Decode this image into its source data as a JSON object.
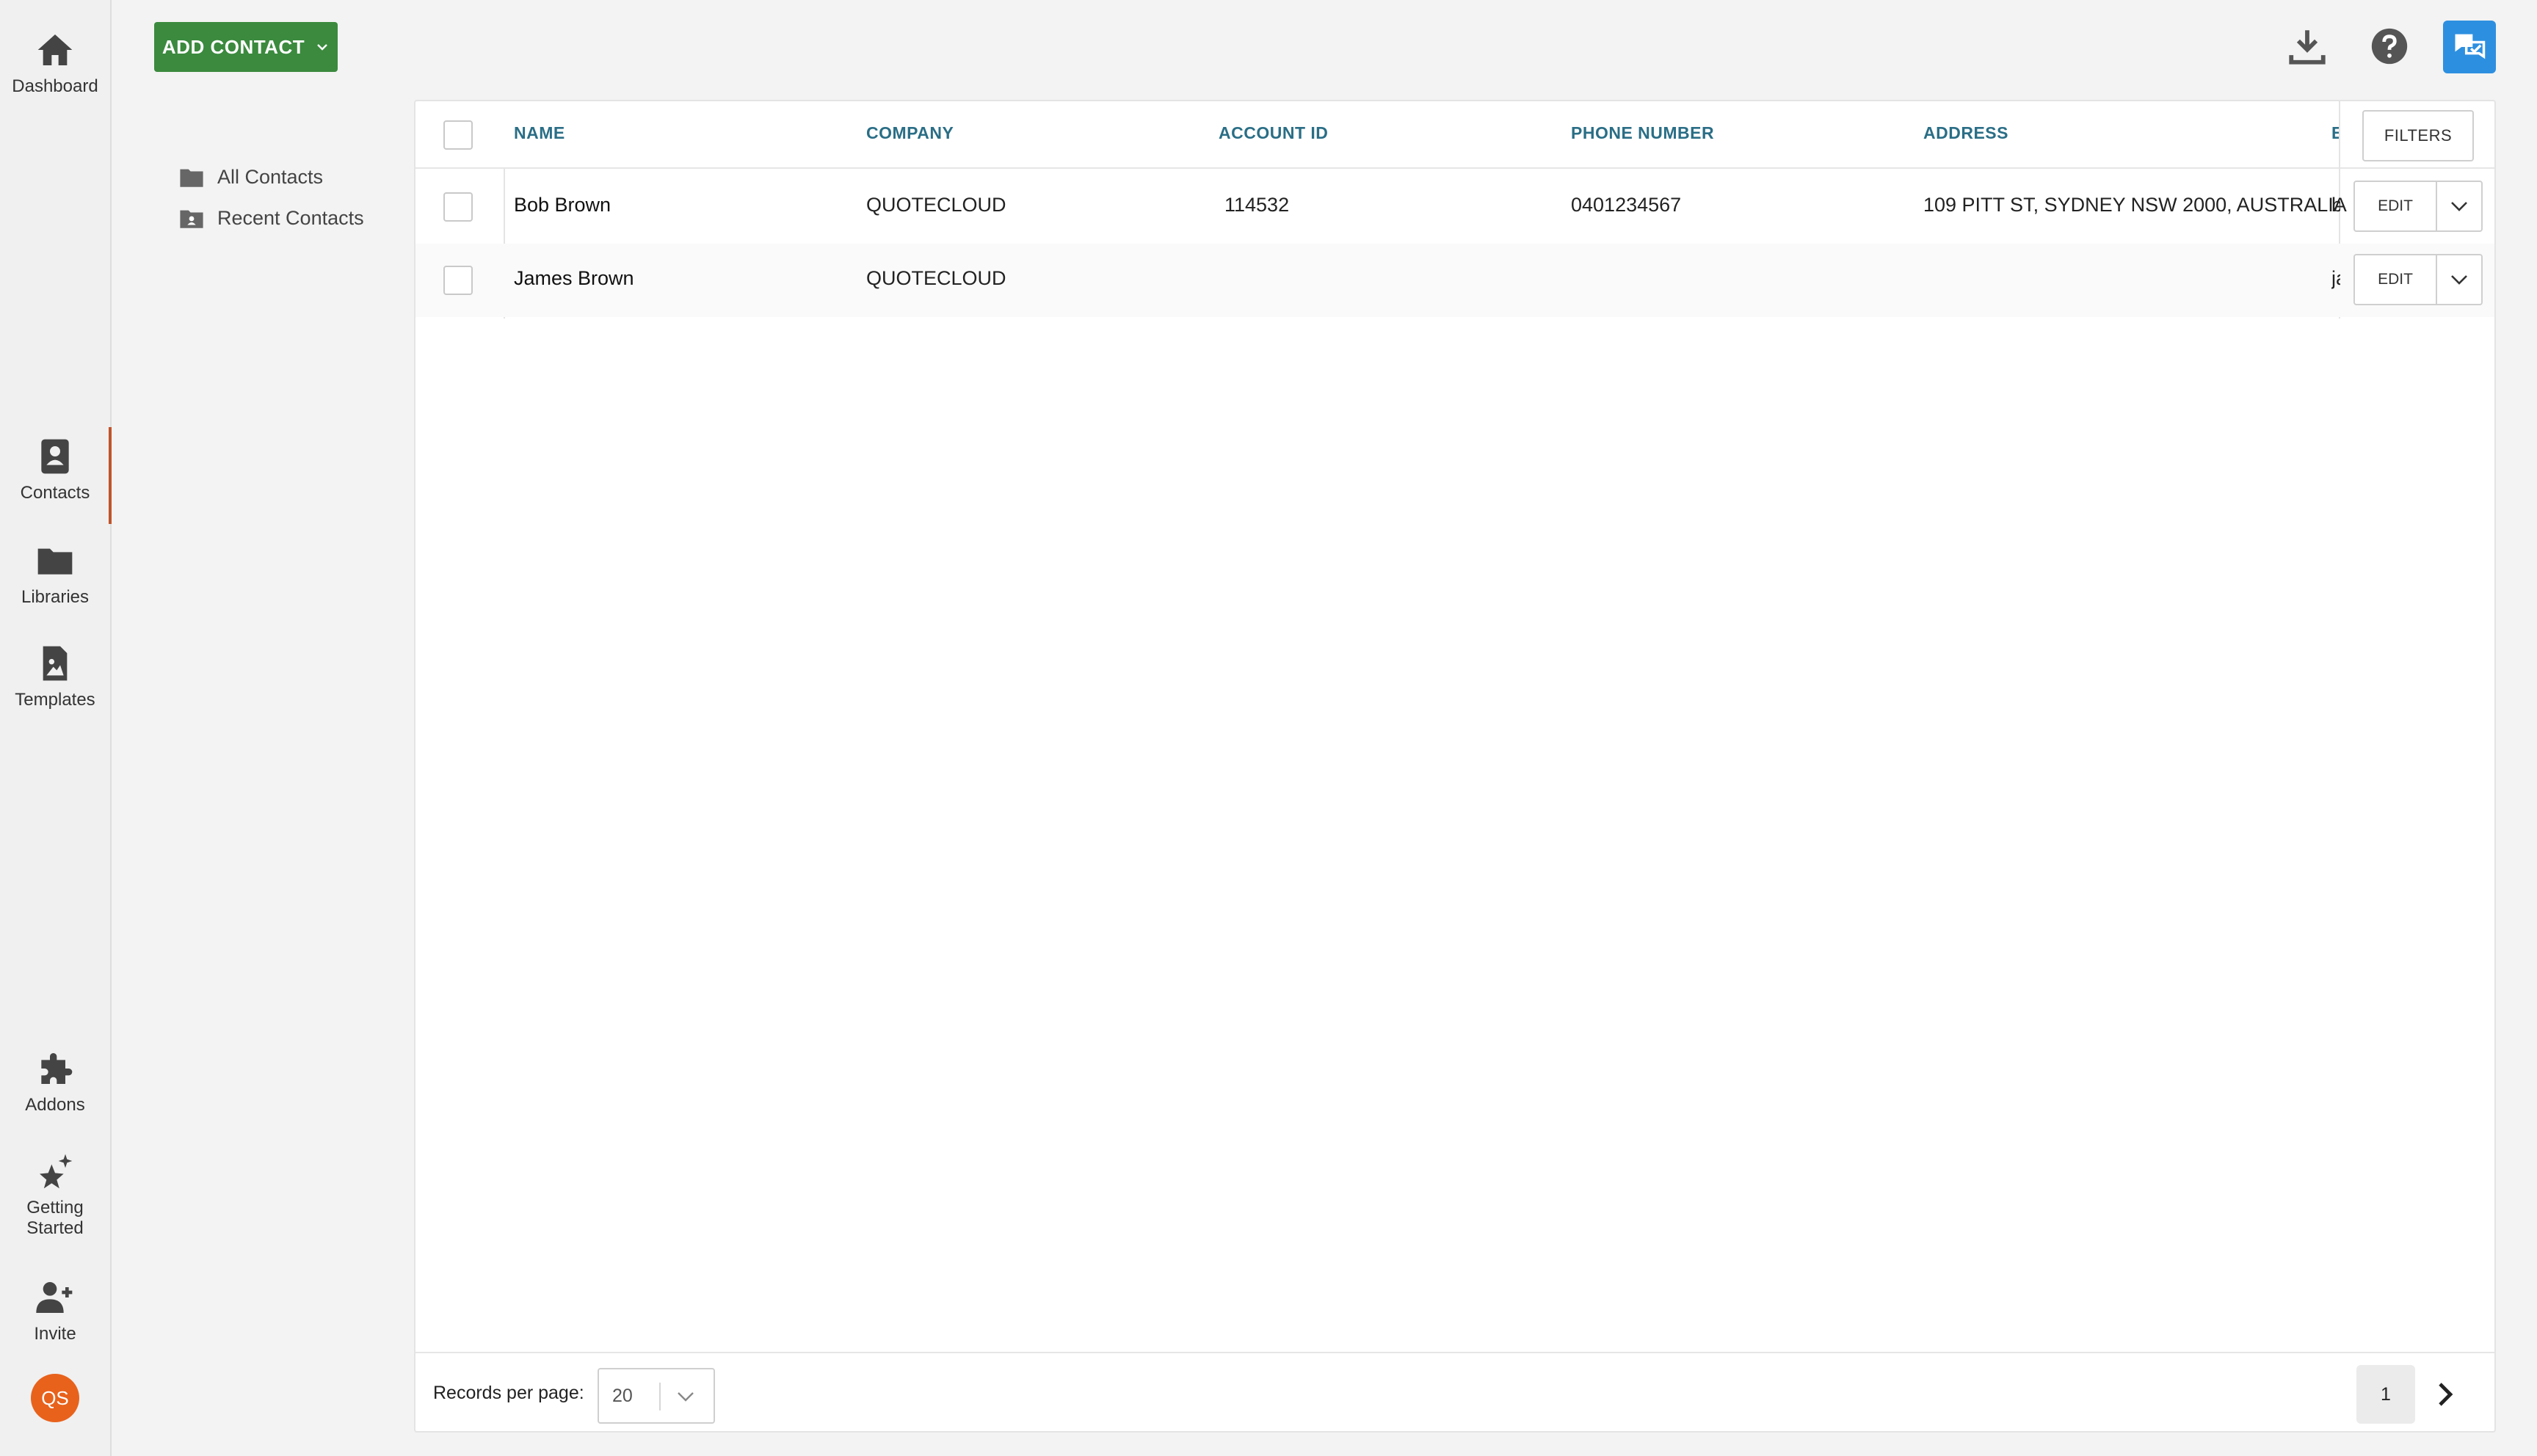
{
  "rail": {
    "dashboard": "Dashboard",
    "contacts": "Contacts",
    "libraries": "Libraries",
    "templates": "Templates",
    "addons": "Addons",
    "getting_started_line1": "Getting",
    "getting_started_line2": "Started",
    "invite": "Invite",
    "avatar_initials": "QS"
  },
  "toolbar": {
    "add_contact": "ADD CONTACT"
  },
  "folders": {
    "all": "All Contacts",
    "recent": "Recent Contacts"
  },
  "table": {
    "columns": {
      "name": "NAME",
      "company": "COMPANY",
      "account_id": "ACCOUNT ID",
      "phone": "PHONE NUMBER",
      "address": "ADDRESS",
      "email_clipped": "E"
    },
    "filters": "FILTERS",
    "rows": [
      {
        "name": "Bob Brown",
        "company": "QUOTECLOUD",
        "account_id": "114532",
        "phone": "0401234567",
        "address": "109 PITT ST, SYDNEY NSW 2000, AUSTRALIA",
        "email_clipped": "b",
        "edit": "EDIT"
      },
      {
        "name": "James Brown",
        "company": "QUOTECLOUD",
        "account_id": "",
        "phone": "",
        "address": "",
        "email_clipped": "ja",
        "edit": "EDIT"
      }
    ]
  },
  "footer": {
    "records_label": "Records per page:",
    "records_value": "20",
    "current_page": "1"
  },
  "colors": {
    "primary_green": "#3b8a3e",
    "header_text": "#2a6e86",
    "active_marker": "#c0542b",
    "chat_blue": "#2d8fe0",
    "avatar": "#e8621c"
  }
}
